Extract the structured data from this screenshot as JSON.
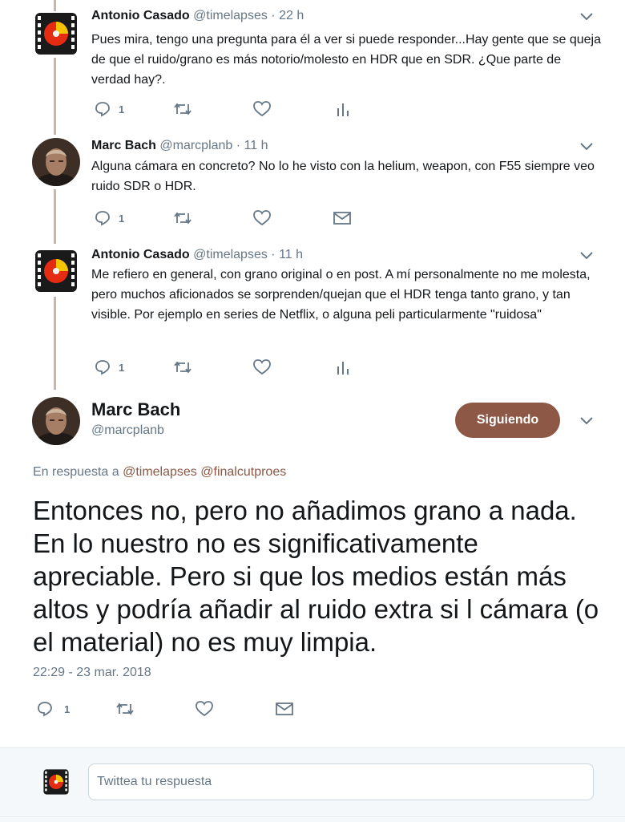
{
  "replies": [
    {
      "name": "Antonio Casado",
      "handle": "@timelapses",
      "dot": "·",
      "time": "22 h",
      "text": "Pues mira, tengo una pregunta para él a ver si puede responder...Hay gente que se queja de que el ruido/grano es más notorio/molesto en HDR que en SDR. ¿Que parte de verdad hay?.",
      "reply_count": "1",
      "avatar": "film-icon"
    },
    {
      "name": "Marc Bach",
      "handle": "@marcplanb",
      "dot": "·",
      "time": "11 h",
      "text": "Alguna cámara en concreto? No lo he visto con la helium, weapon, con F55 siempre veo ruido SDR o HDR.",
      "reply_count": "1",
      "avatar": "person-photo"
    },
    {
      "name": "Antonio Casado",
      "handle": "@timelapses",
      "dot": "·",
      "time": "11 h",
      "text": "Me refiero en general, con grano original o en post. A mí personalmente no me molesta, pero muchos aficionados se sorprenden/quejan que el HDR tenga tanto grano, y tan visible. Por ejemplo en series de Netflix, o alguna peli particularmente \"ruidosa\"",
      "reply_count": "1",
      "avatar": "film-icon"
    }
  ],
  "main_tweet": {
    "name": "Marc Bach",
    "handle": "@marcplanb",
    "follow_label": "Siguiendo",
    "reply_prefix": "En respuesta a",
    "mention_1": "@timelapses",
    "mention_2": "@finalcutproes",
    "text": "Entonces no, pero no añadimos grano a nada. En lo nuestro no es significativamente apreciable. Pero si que los medios están más altos y podría añadir al ruido extra si l cámara (o el material) no es muy limpia.",
    "date": "22:29 - 23 mar. 2018",
    "reply_count": "1"
  },
  "compose": {
    "placeholder": "Twittea tu respuesta"
  },
  "colors": {
    "accent": "#8d5845",
    "thread_line": "#ccb5a8",
    "muted": "#657786"
  }
}
